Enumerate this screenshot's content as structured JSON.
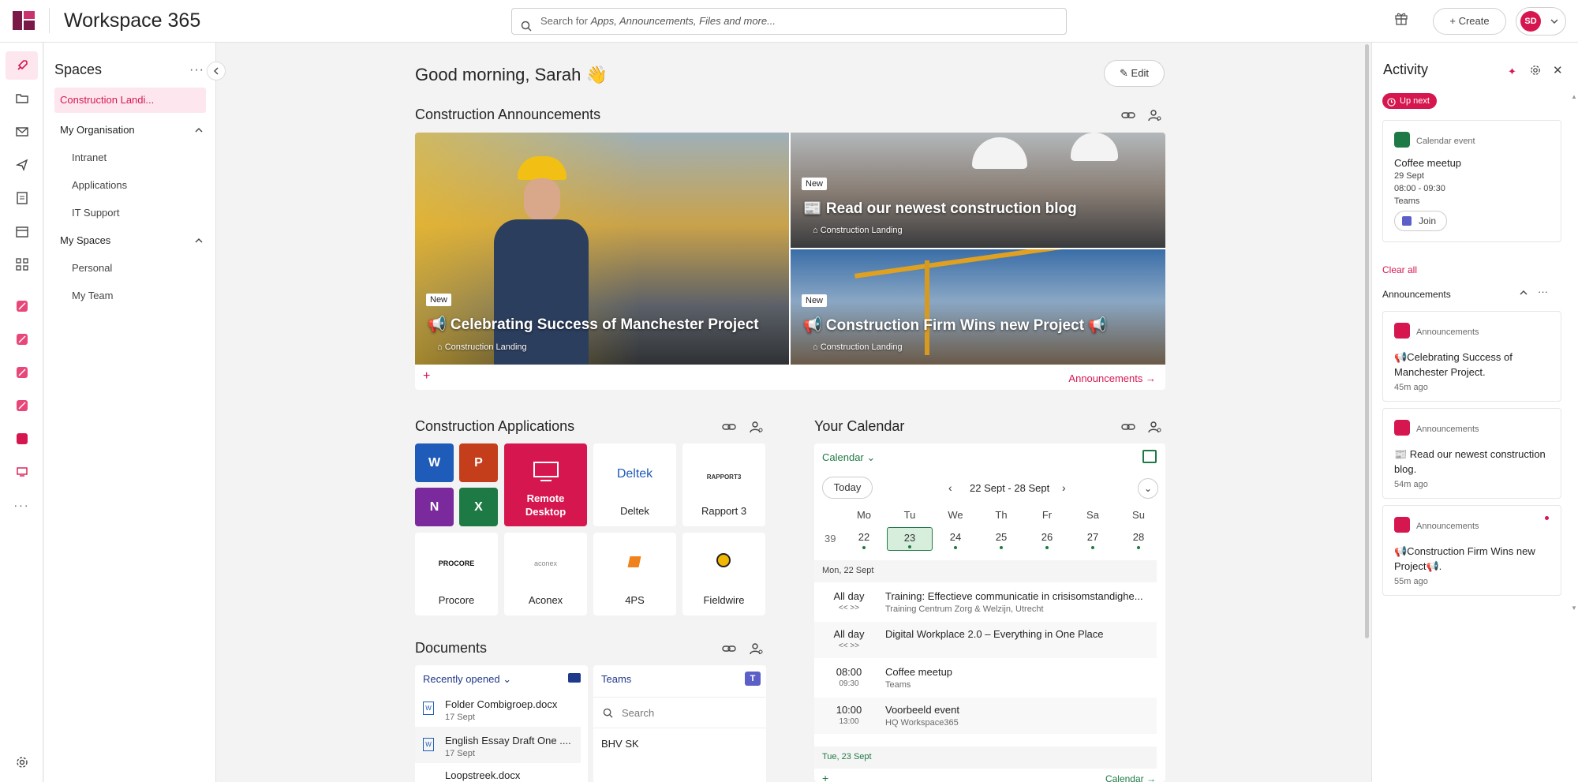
{
  "header": {
    "app_title": "Workspace 365",
    "search_prefix": "Search for ",
    "search_hint": "Apps, Announcements, Files and more...",
    "create_label": "Create",
    "avatar_initials": "SD"
  },
  "spaces": {
    "title": "Spaces",
    "active_item": "Construction Landi...",
    "groups": [
      {
        "label": "My Organisation",
        "items": [
          "Intranet",
          "Applications",
          "IT Support"
        ]
      },
      {
        "label": "My Spaces",
        "items": [
          "Personal",
          "My Team"
        ]
      }
    ]
  },
  "main": {
    "greeting": "Good morning, Sarah",
    "greeting_emoji": "👋",
    "edit_label": "Edit",
    "announcements": {
      "title": "Construction Announcements",
      "footer_link": "Announcements",
      "items": [
        {
          "badge": "New",
          "title": "📢 Celebrating Success of Manchester Project",
          "tag": "Construction Landing"
        },
        {
          "badge": "New",
          "title": "📰 Read our newest construction blog",
          "tag": "Construction Landing"
        },
        {
          "badge": "New",
          "title": "📢 Construction Firm Wins new Project 📢",
          "tag": "Construction Landing"
        }
      ]
    },
    "applications": {
      "title": "Construction Applications",
      "office_letters": [
        "W",
        "P",
        "N",
        "X"
      ],
      "tiles": [
        {
          "label": "Remote Desktop",
          "logo": ""
        },
        {
          "label": "Deltek",
          "logo": "Deltek"
        },
        {
          "label": "Rapport 3",
          "logo": "RAPPORT3"
        },
        {
          "label": "Procore",
          "logo": "PROCORE"
        },
        {
          "label": "Aconex",
          "logo": "aconex"
        },
        {
          "label": "4PS",
          "logo": ""
        },
        {
          "label": "Fieldwire",
          "logo": ""
        }
      ]
    },
    "documents": {
      "title": "Documents",
      "dropdown_label": "Recently opened",
      "files": [
        {
          "name": "Folder Combigroep.docx",
          "date": "17 Sept"
        },
        {
          "name": "English Essay Draft One ....",
          "date": "17 Sept"
        },
        {
          "name": "Loopstreek.docx",
          "date": ""
        }
      ],
      "teams": {
        "title": "Teams",
        "search_placeholder": "Search",
        "items": [
          "BHV SK"
        ]
      }
    },
    "calendar": {
      "title": "Your Calendar",
      "dropdown_label": "Calendar",
      "today_label": "Today",
      "range": "22 Sept - 28 Sept",
      "week_number": "39",
      "weekdays": [
        "Mo",
        "Tu",
        "We",
        "Th",
        "Fr",
        "Sa",
        "Su"
      ],
      "dates": [
        "22",
        "23",
        "24",
        "25",
        "26",
        "27",
        "28"
      ],
      "selected_date": "23",
      "day_heading_1": "Mon, 22 Sept",
      "events": [
        {
          "time": "All day",
          "sub": "<< >>",
          "title": "Training: Effectieve communicatie in crisisomstandighe...",
          "location": "Training Centrum Zorg & Welzijn, Utrecht"
        },
        {
          "time": "All day",
          "sub": "<< >>",
          "title": "Digital Workplace 2.0 – Everything in One Place",
          "location": ""
        },
        {
          "time": "08:00",
          "sub": "09:30",
          "title": "Coffee meetup",
          "location": "Teams"
        },
        {
          "time": "10:00",
          "sub": "13:00",
          "title": "Voorbeeld event",
          "location": "HQ Workspace365"
        }
      ],
      "day_heading_2": "Tue, 23 Sept",
      "footer_link": "Calendar"
    }
  },
  "activity": {
    "title": "Activity",
    "up_next_label": "Up next",
    "event_card": {
      "source": "Calendar event",
      "title": "Coffee meetup",
      "date": "29 Sept",
      "time": "08:00 - 09:30",
      "location": "Teams",
      "join_label": "Join"
    },
    "clear_all": "Clear all",
    "announcements_label": "Announcements",
    "items": [
      {
        "source": "Announcements",
        "text": "📢Celebrating Success of Manchester Project.",
        "ago": "45m ago"
      },
      {
        "source": "Announcements",
        "text": "📰 Read our newest construction blog.",
        "ago": "54m ago"
      },
      {
        "source": "Announcements",
        "text": "📢Construction Firm Wins new Project📢.",
        "ago": "55m ago"
      }
    ]
  }
}
